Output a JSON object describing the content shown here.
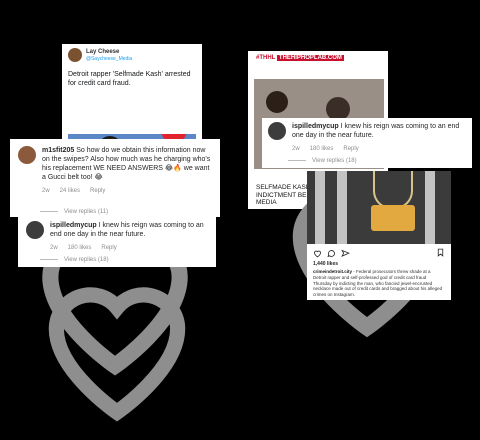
{
  "tweet": {
    "name": "Lay Cheese",
    "handle": "@Saycheese_Media",
    "text": "Detroit rapper 'Selfmade Kash' arrested for credit card fraud."
  },
  "comment1": {
    "user": "m1sfit205",
    "text": "So how do we obtain this information now on the swipes? Also how much was he charging who's his replacement WE NEED ANSWERS 😂🔥 we want a Gucci belt too! 😂",
    "time": "2w",
    "likes": "24 likes",
    "reply": "Reply",
    "view_replies": "View replies (11)"
  },
  "comment2": {
    "user": "ispilledmycup",
    "text": "I knew his reign was coming to an end one day in the near future.",
    "time": "2w",
    "likes": "180 likes",
    "reply": "Reply",
    "view_replies": "View replies (18)"
  },
  "comment3": {
    "user": "ispilledmycup",
    "text": "I knew his reign was coming to an end one day in the near future.",
    "time": "2w",
    "likes": "180 likes",
    "reply": "Reply",
    "view_replies": "View replies (18)"
  },
  "hiphoplab": {
    "brand_prefix": "#THHL",
    "brand": "THEHIPHOPLAB.COM",
    "caption": "SELFMADE KASH INDICTMENT BE... MEDIA"
  },
  "instagram": {
    "likes": "1,440 likes",
    "caption_user": "crimeindetroit.city",
    "caption_text": " - Federal prosecutors threw shade at a Detroit rapper and self-professed god of credit card fraud Thursday by indicting the man, who fancied jewel-encrusted necklace made out of credit cards and bragged about his alleged crimes on Instagram."
  },
  "colors": {
    "accent_red": "#c8102e",
    "twitter_blue": "#1da1f2",
    "meta_gray": "#8e8e8e"
  }
}
